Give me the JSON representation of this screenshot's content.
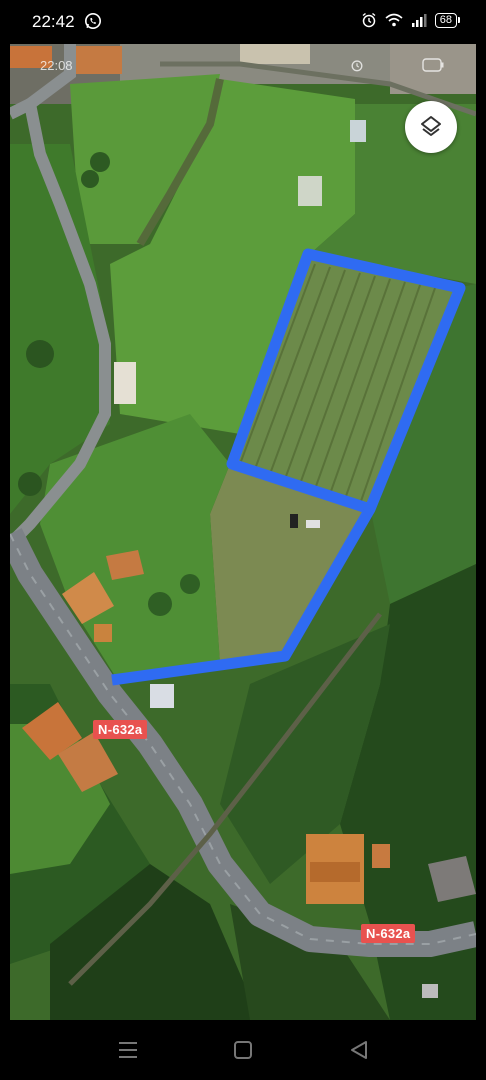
{
  "status_bar": {
    "time": "22:42",
    "battery": "68",
    "icons": [
      "whatsapp-icon",
      "alarm-icon",
      "wifi-icon",
      "signal-icon",
      "battery-icon"
    ]
  },
  "inner_screenshot": {
    "time": "22:08"
  },
  "map": {
    "layers_icon": "layers-icon",
    "road_labels": [
      "N-632a",
      "N-632a"
    ],
    "outline_color": "#2f6bf2",
    "road_label_color": "#e8524f"
  },
  "nav_bar": {
    "buttons": [
      "menu-icon",
      "home-icon",
      "back-icon"
    ]
  }
}
